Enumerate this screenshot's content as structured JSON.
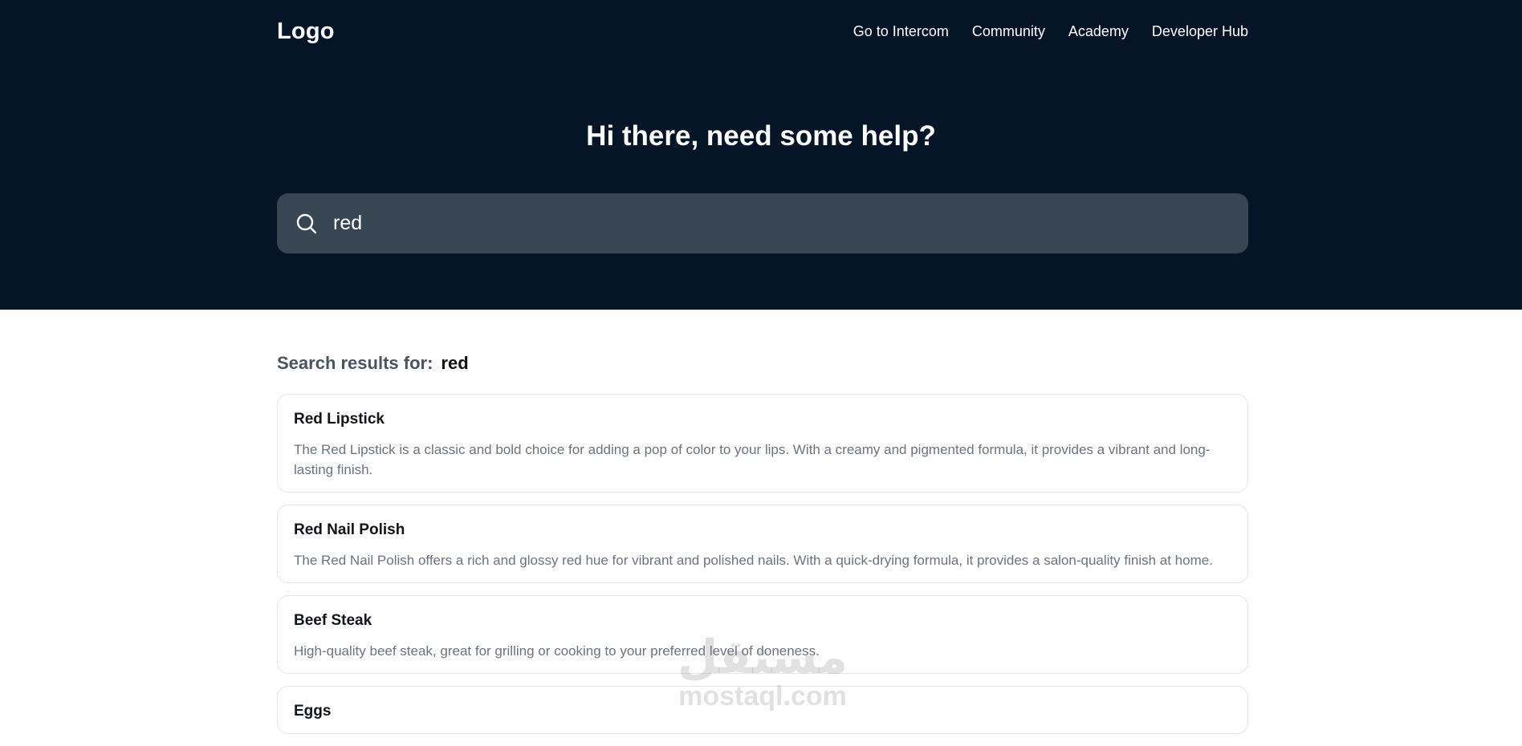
{
  "header": {
    "logo": "Logo",
    "nav": [
      {
        "label": "Go to Intercom"
      },
      {
        "label": "Community"
      },
      {
        "label": "Academy"
      },
      {
        "label": "Developer Hub"
      }
    ]
  },
  "hero": {
    "title": "Hi there, need some help?",
    "search": {
      "value": "red",
      "icon": "search-icon"
    }
  },
  "results": {
    "heading_label": "Search results for:",
    "query": "red",
    "items": [
      {
        "title": "Red Lipstick",
        "description": "The Red Lipstick is a classic and bold choice for adding a pop of color to your lips. With a creamy and pigmented formula, it provides a vibrant and long-lasting finish."
      },
      {
        "title": "Red Nail Polish",
        "description": "The Red Nail Polish offers a rich and glossy red hue for vibrant and polished nails. With a quick-drying formula, it provides a salon-quality finish at home."
      },
      {
        "title": "Beef Steak",
        "description": "High-quality beef steak, great for grilling or cooking to your preferred level of doneness."
      },
      {
        "title": "Eggs",
        "description": ""
      }
    ]
  },
  "watermark": {
    "mark": "مستقل",
    "text": "mostaql.com"
  },
  "colors": {
    "hero_bg": "#051427",
    "search_bg": "#384654",
    "card_border": "#e3e6ea",
    "desc_text": "#6b7480"
  }
}
